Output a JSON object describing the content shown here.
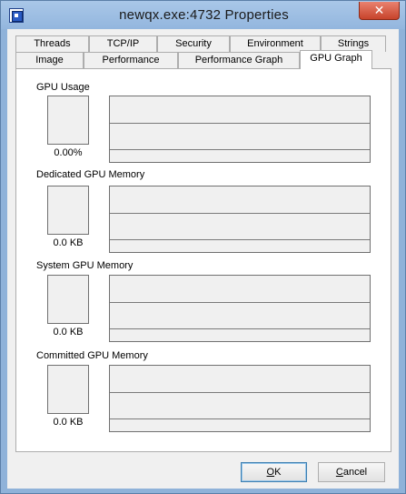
{
  "window": {
    "title": "newqx.exe:4732 Properties",
    "close_glyph": "✕",
    "icon": "process-icon"
  },
  "tabs_back": [
    "Threads",
    "TCP/IP",
    "Security",
    "Environment",
    "Strings"
  ],
  "tabs_front": [
    "Image",
    "Performance",
    "Performance Graph",
    "GPU Graph"
  ],
  "active_tab": "GPU Graph",
  "sections": [
    {
      "title": "GPU Usage",
      "value": "0.00%"
    },
    {
      "title": "Dedicated GPU Memory",
      "value": "0.0 KB"
    },
    {
      "title": "System GPU Memory",
      "value": "0.0 KB"
    },
    {
      "title": "Committed GPU Memory",
      "value": "0.0 KB"
    }
  ],
  "buttons": {
    "ok": {
      "label": "OK",
      "accel": "O"
    },
    "cancel": {
      "label": "Cancel",
      "accel": "C"
    }
  }
}
